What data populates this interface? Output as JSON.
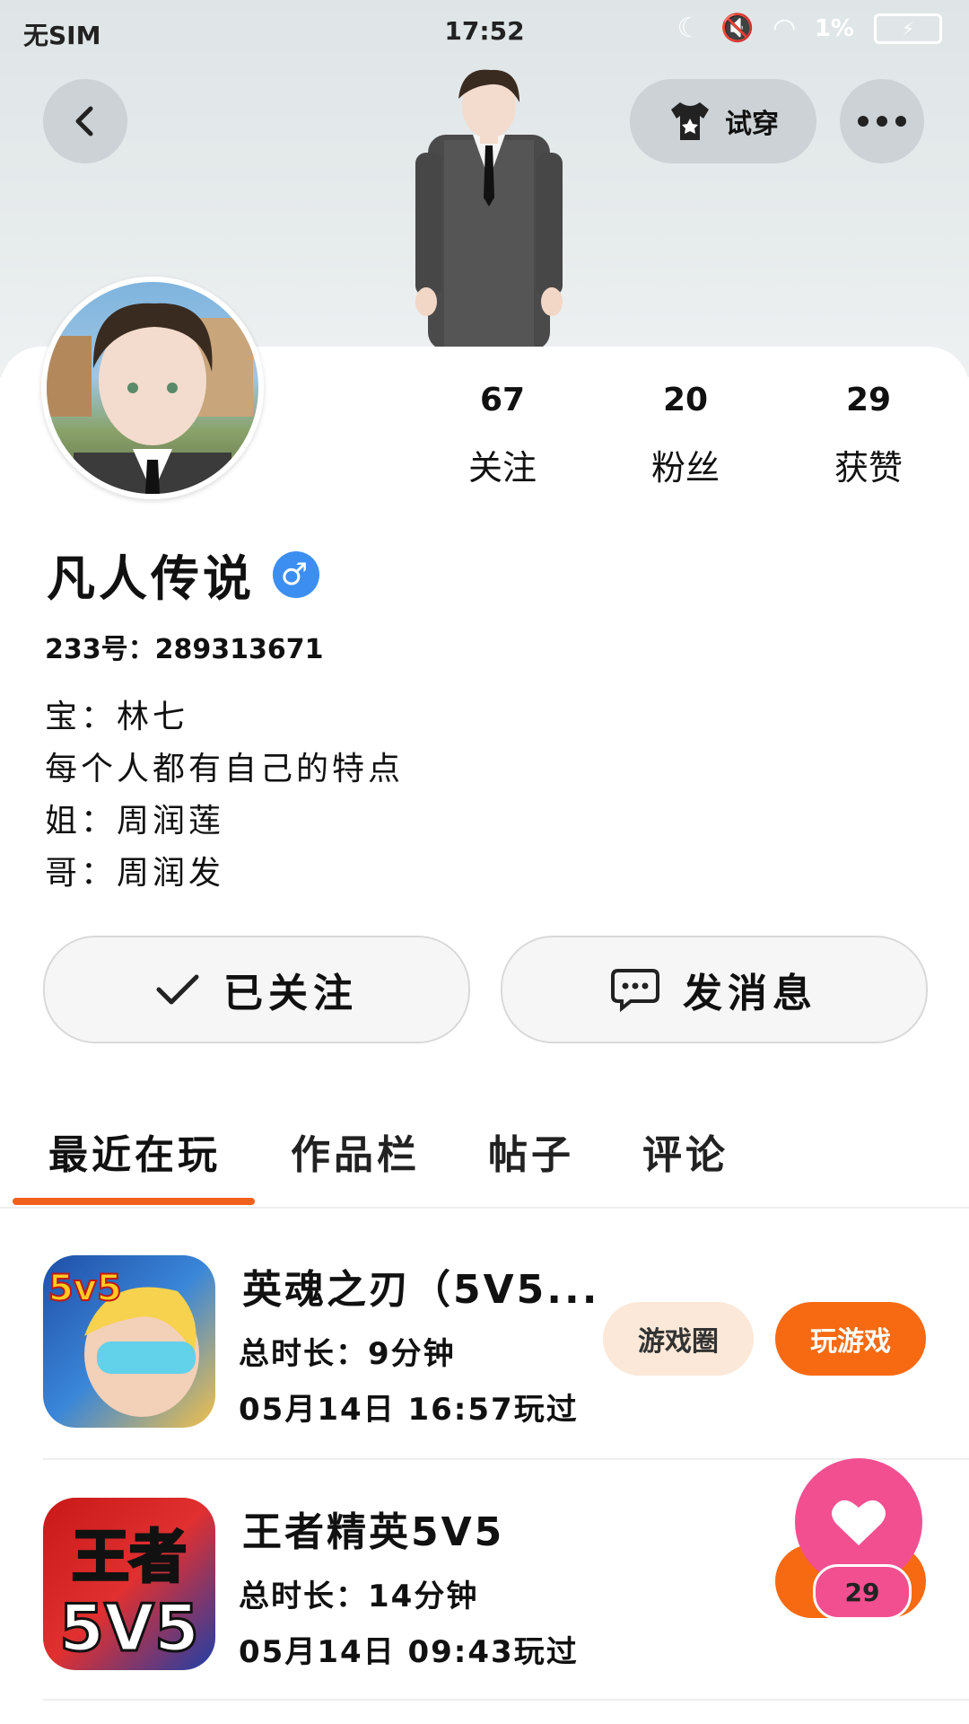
{
  "status_bar": {
    "carrier": "无SIM",
    "time": "17:52",
    "battery": "1%"
  },
  "header": {
    "tryon_label": "试穿"
  },
  "profile": {
    "name": "凡人传说",
    "gender_symbol": "♂",
    "uid_label": "233号：",
    "uid": "289313671",
    "bio_lines": [
      "宝：林七",
      "每个人都有自己的特点",
      "姐：周润莲",
      "哥：周润发"
    ]
  },
  "stats": [
    {
      "num": "67",
      "label": "关注"
    },
    {
      "num": "20",
      "label": "粉丝"
    },
    {
      "num": "29",
      "label": "获赞"
    }
  ],
  "actions": {
    "followed_label": "已关注",
    "message_label": "发消息"
  },
  "tabs": [
    "最近在玩",
    "作品栏",
    "帖子",
    "评论"
  ],
  "games": [
    {
      "title": "英魂之刃（5V5...",
      "duration": "总时长：9分钟",
      "last_played": "05月14日 16:57玩过",
      "circle_label": "游戏圈",
      "play_label": "玩游戏",
      "icon_text": "5v5"
    },
    {
      "title": "王者精英5V5",
      "duration": "总时长：14分钟",
      "last_played": "05月14日 09:43玩过",
      "icon_text_top": "王者",
      "icon_text_bottom": "5V5"
    }
  ],
  "like_fab": {
    "count": "29"
  },
  "colors": {
    "accent": "#f2601c",
    "like": "#f24f91",
    "gender": "#3c8ff0",
    "circle_bg": "#fbe8d8",
    "play_bg": "#f76a12"
  }
}
